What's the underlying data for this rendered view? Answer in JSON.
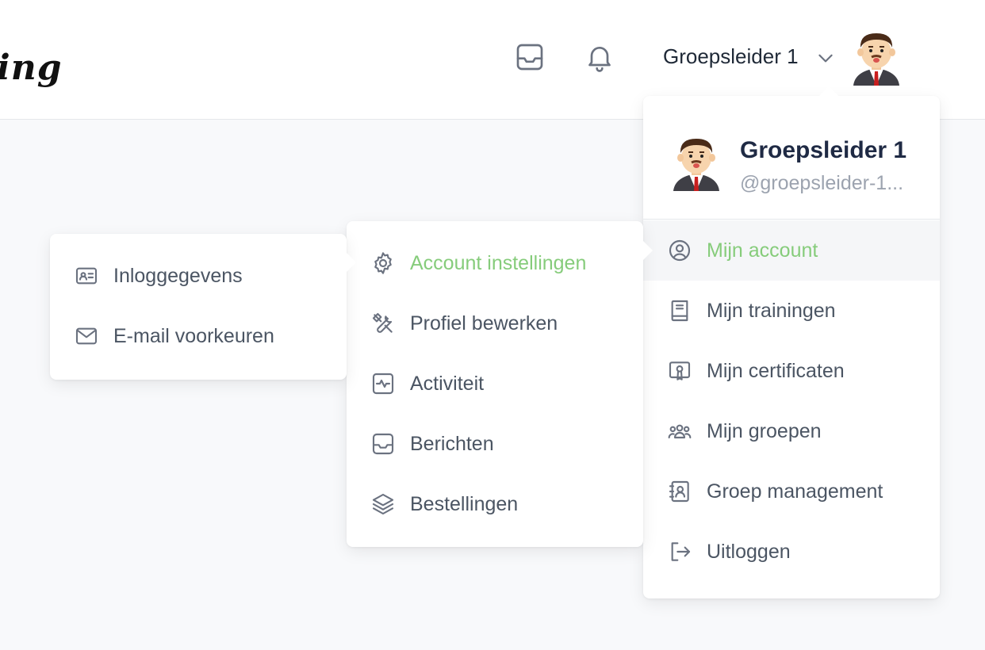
{
  "header": {
    "logo_text": "ing",
    "user_name": "Groepsleider 1",
    "icons": [
      "inbox-icon",
      "bell-icon",
      "chevron-down-icon"
    ]
  },
  "profile_menu": {
    "name": "Groepsleider 1",
    "username": "@groepsleider-1...",
    "items": [
      {
        "label": "Mijn account",
        "icon": "user-circle-icon",
        "active": true
      },
      {
        "label": "Mijn trainingen",
        "icon": "book-icon"
      },
      {
        "label": "Mijn certificaten",
        "icon": "certificate-icon"
      },
      {
        "label": "Mijn groepen",
        "icon": "users-icon"
      },
      {
        "label": "Groep management",
        "icon": "contact-book-icon"
      },
      {
        "label": "Uitloggen",
        "icon": "logout-icon"
      }
    ]
  },
  "account_menu": {
    "items": [
      {
        "label": "Account instellingen",
        "icon": "gear-icon",
        "active": true
      },
      {
        "label": "Profiel bewerken",
        "icon": "tools-icon"
      },
      {
        "label": "Activiteit",
        "icon": "activity-icon"
      },
      {
        "label": "Berichten",
        "icon": "inbox-icon"
      },
      {
        "label": "Bestellingen",
        "icon": "layers-icon"
      }
    ]
  },
  "settings_menu": {
    "items": [
      {
        "label": "Inloggegevens",
        "icon": "id-card-icon"
      },
      {
        "label": "E-mail voorkeuren",
        "icon": "mail-icon"
      }
    ]
  },
  "colors": {
    "accent": "#86cc7b",
    "text": "#4b5563",
    "heading": "#1f2a44",
    "muted": "#9ca3af"
  }
}
